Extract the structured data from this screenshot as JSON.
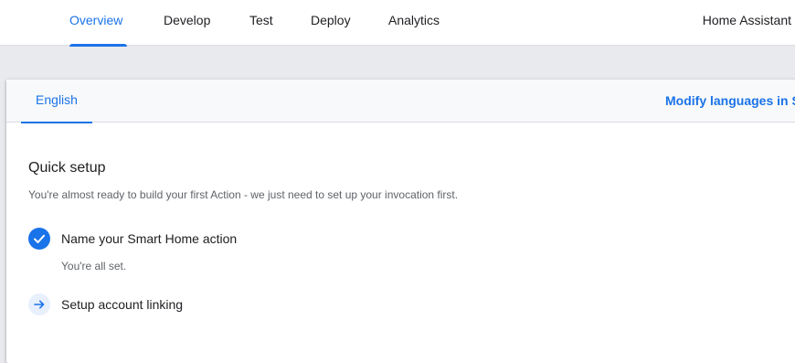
{
  "nav": {
    "tabs": [
      {
        "label": "Overview",
        "active": true
      },
      {
        "label": "Develop",
        "active": false
      },
      {
        "label": "Test",
        "active": false
      },
      {
        "label": "Deploy",
        "active": false
      },
      {
        "label": "Analytics",
        "active": false
      }
    ],
    "project_name": "Home Assistant"
  },
  "language_bar": {
    "active_language": "English",
    "modify_link": "Modify languages in S"
  },
  "quick_setup": {
    "title": "Quick setup",
    "description": "You're almost ready to build your first Action - we just need to set up your invocation first.",
    "steps": [
      {
        "label": "Name your Smart Home action",
        "status_text": "You're all set.",
        "icon": "check-circle-icon",
        "done": true
      },
      {
        "label": "Setup account linking",
        "icon": "arrow-right-icon",
        "done": false
      }
    ]
  },
  "colors": {
    "accent": "#1a73e8",
    "accent_light": "#e8f0fe",
    "page_background": "#e8eaed",
    "secondary_text": "#5f6368"
  }
}
